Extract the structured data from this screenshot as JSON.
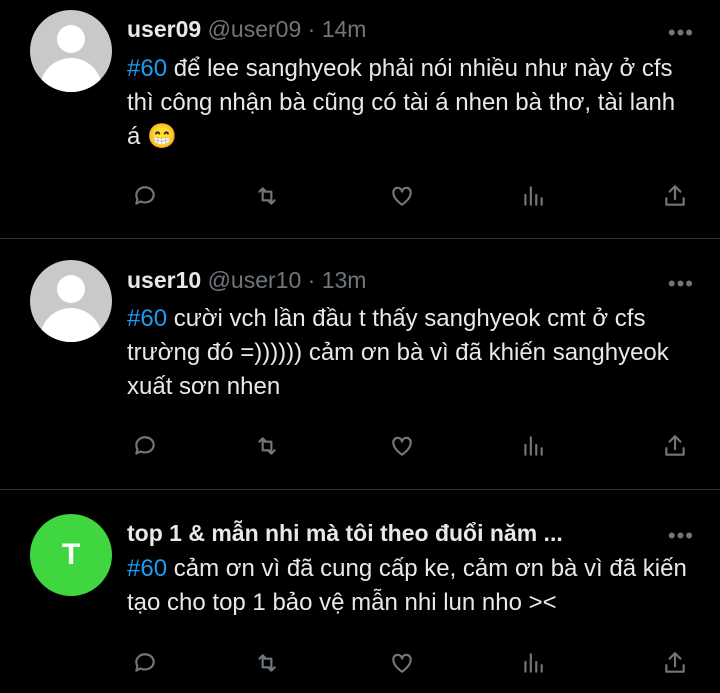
{
  "tweets": [
    {
      "avatar": "default-avatar",
      "name": "user09",
      "handle": "@user09",
      "separator": "·",
      "time": "14m",
      "hashtag": "#60",
      "text": " để lee sanghyeok phải nói nhiều như này ở cfs thì công nhận bà cũng có tài á nhen bà thơ, tài lanh á 😁"
    },
    {
      "avatar": "default-avatar",
      "name": "user10",
      "handle": "@user10",
      "separator": "·",
      "time": "13m",
      "hashtag": "#60",
      "text": " cười vch lần đầu t thấy sanghyeok cmt ở cfs trường đó =)))))) cảm ơn bà vì đã khiến sanghyeok xuất sơn nhen"
    },
    {
      "avatar_letter": "T",
      "avatar_color": "#3fd63f",
      "name": "top 1 & mẫn nhi mà tôi theo đuổi năm ...",
      "hashtag": "#60",
      "text": " cảm ơn vì đã cung cấp ke, cảm ơn bà vì đã kiến tạo cho top 1 bảo vệ mẫn nhi lun nho ><"
    }
  ],
  "more_label": "•••",
  "icons": [
    "reply-icon",
    "retweet-icon",
    "like-icon",
    "views-icon",
    "share-icon"
  ],
  "colors": {
    "hashtag": "#1d9bf0",
    "muted": "#71767b",
    "background": "#000000"
  }
}
